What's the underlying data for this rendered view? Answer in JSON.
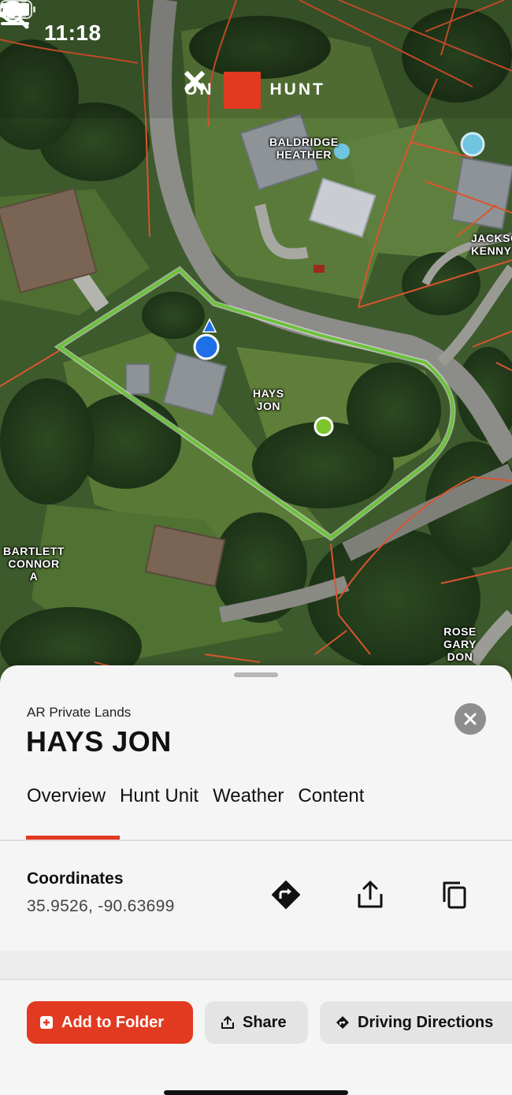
{
  "status_bar": {
    "time": "11:18"
  },
  "map": {
    "logo_left": "ON",
    "logo_right": "HUNT",
    "labels": [
      {
        "id": "baldridge",
        "text": "BALDRIDGE\nHEATHER"
      },
      {
        "id": "jackson",
        "text": "JACKSO\nKENNY"
      },
      {
        "id": "hays",
        "text": "HAYS\nJON"
      },
      {
        "id": "bartlett",
        "text": "BARTLETT\nCONNOR\nA"
      },
      {
        "id": "rose",
        "text": "ROSE\nGARY\nDON"
      }
    ],
    "colors": {
      "parcel_outline": "#6cc23a",
      "parcel_lines": "#d9552e",
      "user_location": "#1e6fe8",
      "marker": "#7cc42b"
    }
  },
  "sheet": {
    "subtitle": "AR Private Lands",
    "title": "HAYS JON",
    "tabs": [
      "Overview",
      "Hunt Unit",
      "Weather",
      "Content"
    ],
    "active_tab": "Overview",
    "coordinates_label": "Coordinates",
    "coordinates_value": "35.9526, -90.63699",
    "buttons": {
      "add_to_folder": "Add to Folder",
      "share": "Share",
      "driving_directions": "Driving Directions"
    },
    "accent_color": "#e23a20"
  },
  "icons": [
    "menu-icon",
    "search-icon",
    "close-icon",
    "directions-icon",
    "share-icon",
    "copy-icon",
    "folder-add-icon",
    "location-arrow-icon",
    "signal-icon",
    "wifi-icon",
    "battery-icon"
  ]
}
